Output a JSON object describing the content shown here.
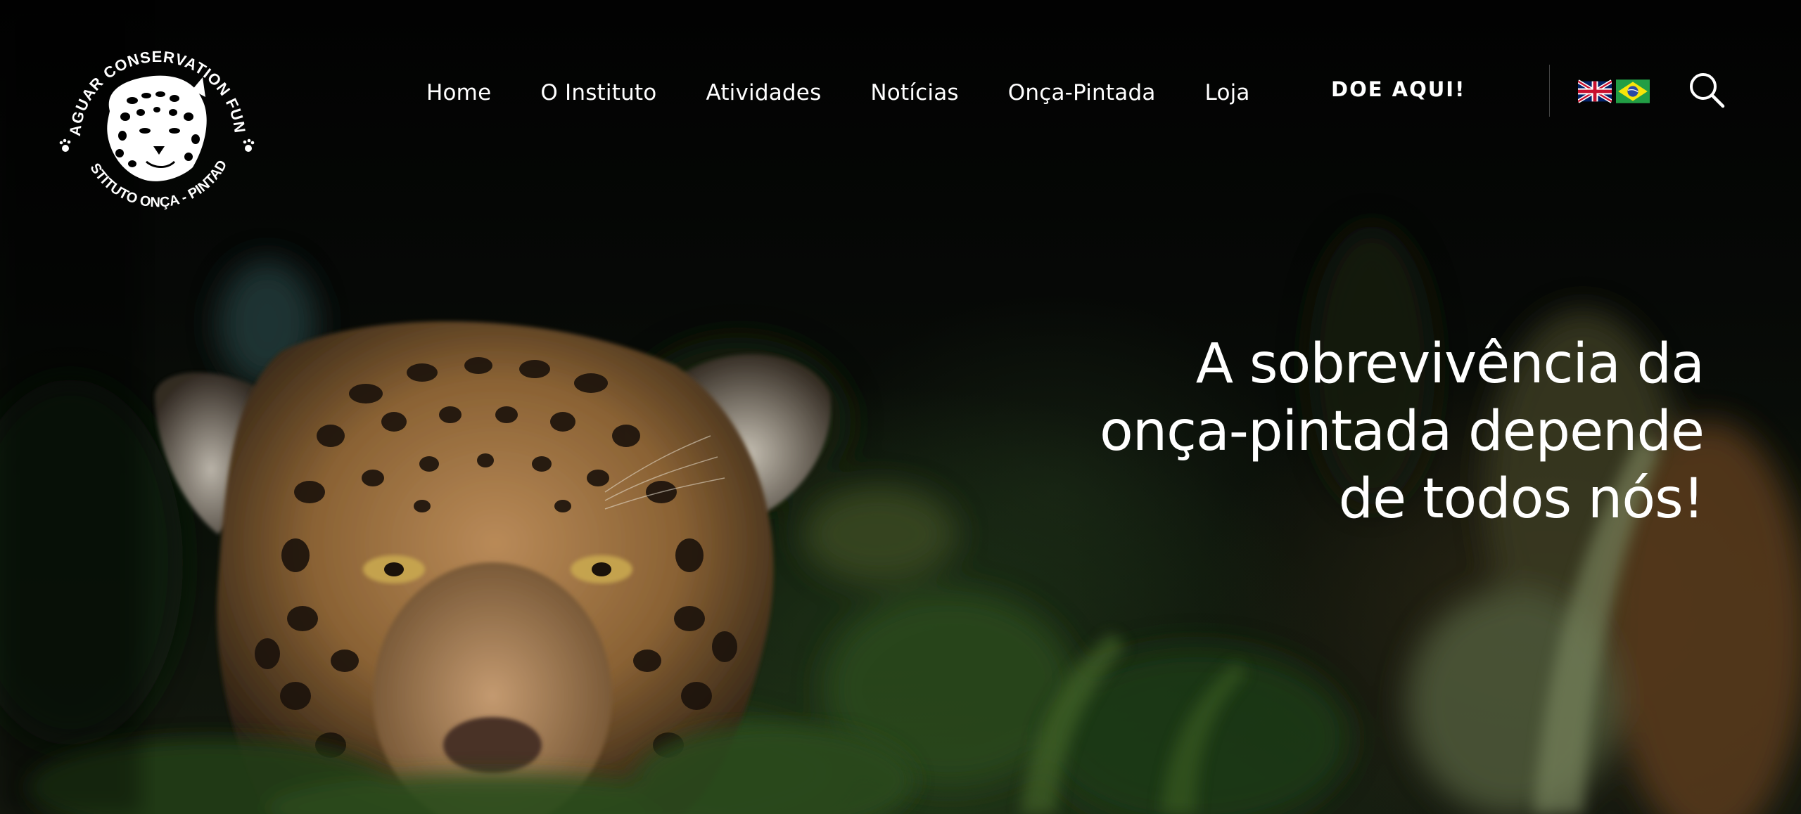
{
  "logo": {
    "top_text": "JAGUAR CONSERVATION FUND",
    "bottom_text": "INSTITUTO ONÇA - PINTADA"
  },
  "nav": {
    "items": [
      {
        "label": "Home"
      },
      {
        "label": "O Instituto"
      },
      {
        "label": "Atividades"
      },
      {
        "label": "Notícias"
      },
      {
        "label": "Onça-Pintada"
      },
      {
        "label": "Loja"
      }
    ],
    "donate_label": "DOE AQUI!"
  },
  "languages": [
    {
      "icon": "uk-flag-icon"
    },
    {
      "icon": "brazil-flag-icon"
    }
  ],
  "search": {
    "icon": "search-icon"
  },
  "hero": {
    "headline_lines": [
      "A sobrevivência da",
      "onça-pintada depende",
      "de todos nós!"
    ]
  },
  "colors": {
    "text": "#ffffff",
    "background": "#050505",
    "brazil_green": "#229e45",
    "brazil_yellow": "#f8e509",
    "brazil_blue": "#2b49a3",
    "uk_blue": "#012169",
    "uk_red": "#c8102e"
  }
}
